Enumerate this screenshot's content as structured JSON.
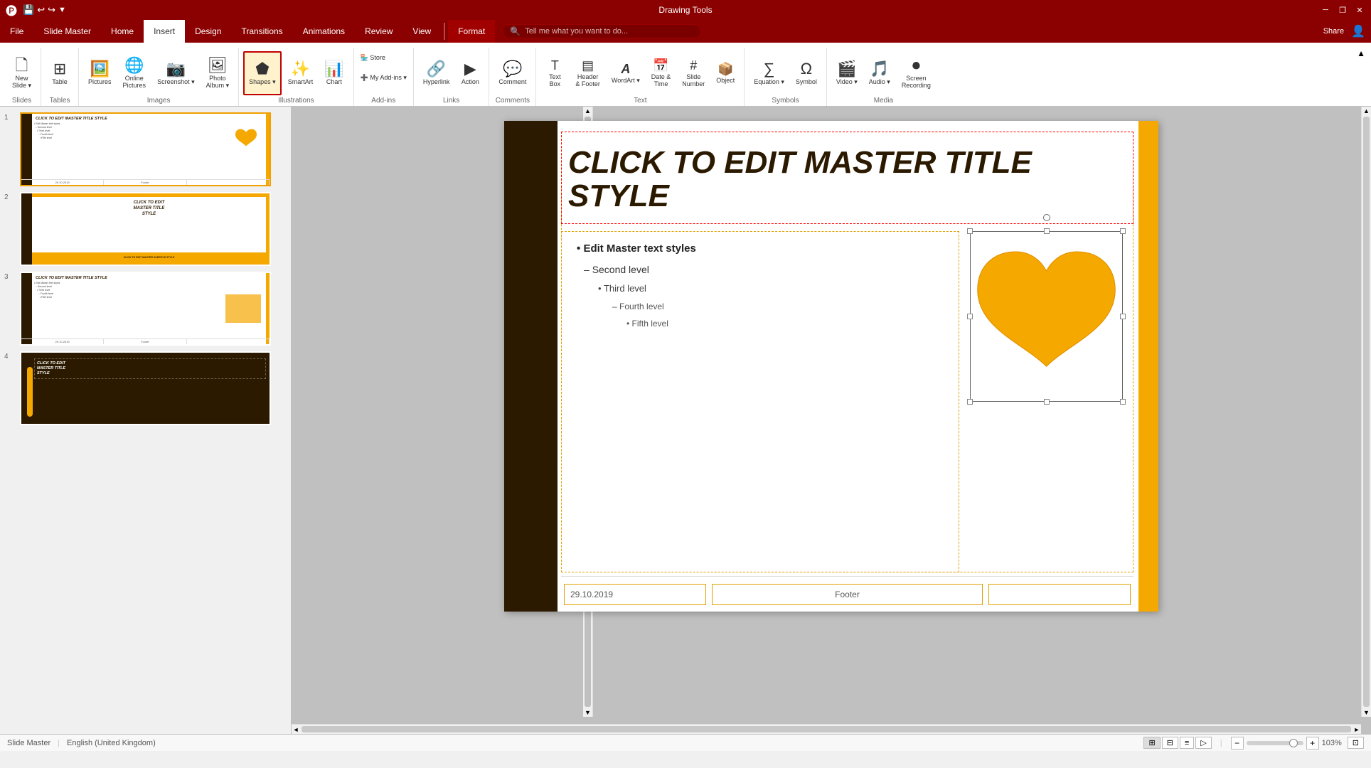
{
  "titleBar": {
    "drawingTools": "Drawing Tools",
    "appTitle": "Microsoft PowerPoint",
    "quickAccess": [
      "save",
      "undo",
      "redo",
      "customize"
    ],
    "windowControls": [
      "minimize",
      "restore",
      "close"
    ]
  },
  "ribbonTabs": [
    {
      "id": "file",
      "label": "File"
    },
    {
      "id": "slide-master",
      "label": "Slide Master"
    },
    {
      "id": "home",
      "label": "Home"
    },
    {
      "id": "insert",
      "label": "Insert",
      "active": true
    },
    {
      "id": "design",
      "label": "Design"
    },
    {
      "id": "transitions",
      "label": "Transitions"
    },
    {
      "id": "animations",
      "label": "Animations"
    },
    {
      "id": "review",
      "label": "Review"
    },
    {
      "id": "view",
      "label": "View"
    },
    {
      "id": "format",
      "label": "Format"
    },
    {
      "id": "share",
      "label": "Share"
    }
  ],
  "ribbon": {
    "groups": [
      {
        "label": "Slides",
        "items": [
          {
            "icon": "🗋",
            "label": "New\nSlide",
            "dropdown": true
          }
        ]
      },
      {
        "label": "Tables",
        "items": [
          {
            "icon": "⊞",
            "label": "Table",
            "dropdown": true
          }
        ]
      },
      {
        "label": "Images",
        "items": [
          {
            "icon": "🖼",
            "label": "Pictures"
          },
          {
            "icon": "🌐",
            "label": "Online\nPictures"
          },
          {
            "icon": "📷",
            "label": "Screenshot",
            "dropdown": true
          },
          {
            "icon": "🖼",
            "label": "Photo\nAlbum",
            "dropdown": true
          }
        ]
      },
      {
        "label": "Illustrations",
        "items": [
          {
            "icon": "⬟",
            "label": "Shapes",
            "dropdown": true,
            "highlighted": true
          },
          {
            "icon": "✨",
            "label": "SmartArt"
          },
          {
            "icon": "📊",
            "label": "Chart"
          }
        ]
      },
      {
        "label": "Add-ins",
        "items": [
          {
            "icon": "🏪",
            "label": "Store"
          },
          {
            "icon": "➕",
            "label": "My Add-ins",
            "dropdown": true
          }
        ]
      },
      {
        "label": "Links",
        "items": [
          {
            "icon": "🔗",
            "label": "Hyperlink"
          },
          {
            "icon": "▶",
            "label": "Action"
          }
        ]
      },
      {
        "label": "Comments",
        "items": [
          {
            "icon": "💬",
            "label": "Comment"
          }
        ]
      },
      {
        "label": "Text",
        "items": [
          {
            "icon": "T",
            "label": "Text\nBox"
          },
          {
            "icon": "▤",
            "label": "Header\n& Footer"
          },
          {
            "icon": "A",
            "label": "WordArt",
            "dropdown": true
          },
          {
            "icon": "📅",
            "label": "Date &\nTime"
          },
          {
            "icon": "#",
            "label": "Slide\nNumber"
          },
          {
            "icon": "📦",
            "label": "Object"
          }
        ]
      },
      {
        "label": "Symbols",
        "items": [
          {
            "icon": "∑",
            "label": "Equation",
            "dropdown": true
          },
          {
            "icon": "Ω",
            "label": "Symbol"
          }
        ]
      },
      {
        "label": "Media",
        "items": [
          {
            "icon": "🎬",
            "label": "Video",
            "dropdown": true
          },
          {
            "icon": "🎵",
            "label": "Audio",
            "dropdown": true
          },
          {
            "icon": "⏺",
            "label": "Screen\nRecording"
          }
        ]
      }
    ],
    "tellMe": "Tell me what you want to do...",
    "shareLabel": "Share"
  },
  "slides": [
    {
      "num": 1,
      "selected": true,
      "title": "CLICK TO EDIT MASTER TITLE STYLE",
      "hasHeart": true,
      "date": "29.10.2019",
      "footer": "Footer"
    },
    {
      "num": 2,
      "selected": false,
      "title": "CLICK TO EDIT MASTER TITLE STYLE",
      "subtitle": "CLICK TO EDIT MASTER SUBTITLE STYLE"
    },
    {
      "num": 3,
      "selected": false,
      "title": "CLICK TO EDIT MASTER TITLE STYLE",
      "hasImages": true
    },
    {
      "num": 4,
      "selected": false,
      "title": "CLICK TO EDIT MASTER TITLE"
    }
  ],
  "mainSlide": {
    "title": "CLICK TO EDIT MASTER TITLE STYLE",
    "content": {
      "l1": "Edit Master text styles",
      "l2": "Second level",
      "l3": "Third level",
      "l4": "Fourth level",
      "l5": "Fifth level"
    },
    "date": "29.10.2019",
    "footer": "Footer",
    "pageNum": ""
  },
  "statusBar": {
    "slideMaster": "Slide Master",
    "language": "English (United Kingdom)",
    "viewNormal": "",
    "viewSlide": "",
    "viewOutline": "",
    "viewPresenter": "",
    "zoom": "103%",
    "fitPage": ""
  }
}
